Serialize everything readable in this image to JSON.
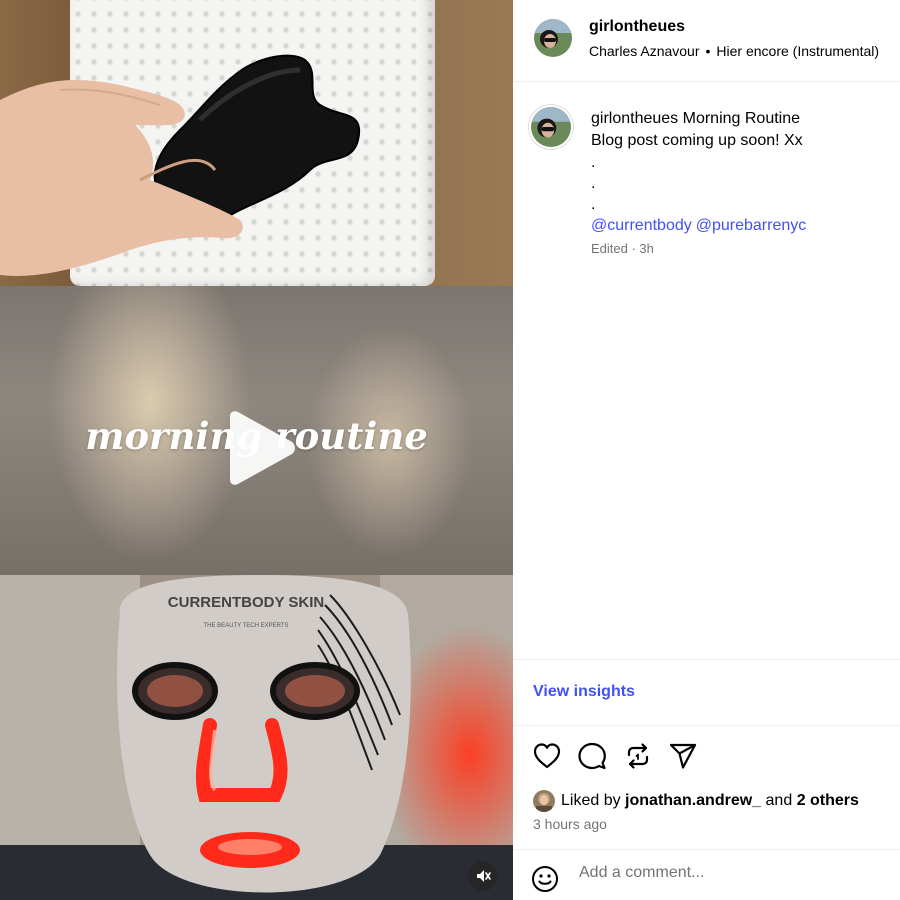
{
  "post": {
    "video_overlay_text": "morning routine",
    "mask_brand": "CURRENTBODY SKIN",
    "mask_tagline": "THE BEAUTY TECH EXPERTS"
  },
  "header": {
    "username": "girlontheues",
    "audio_artist": "Charles Aznavour",
    "audio_separator": "•",
    "audio_track": "Hier encore (Instrumental)"
  },
  "caption": {
    "username": "girlontheues",
    "title": "Morning Routine",
    "line2": "Blog post coming up soon! Xx",
    "dots": [
      ".",
      ".",
      "."
    ],
    "mentions": [
      "@currentbody",
      "@purebarrenyc"
    ],
    "meta": "Edited · 3h"
  },
  "insights": {
    "label": "View insights"
  },
  "actions": {
    "icons": [
      "heart-icon",
      "comment-icon",
      "repost-icon",
      "share-icon"
    ]
  },
  "likes": {
    "prefix": "Liked by",
    "user": "jonathan.andrew_",
    "conj": "and",
    "others": "2 others"
  },
  "timestamp": "3 hours ago",
  "comment": {
    "placeholder": "Add a comment..."
  },
  "colors": {
    "link": "#4150f7",
    "muted": "#737373",
    "divider": "#efefef",
    "mask_red": "#ff2a1a"
  }
}
